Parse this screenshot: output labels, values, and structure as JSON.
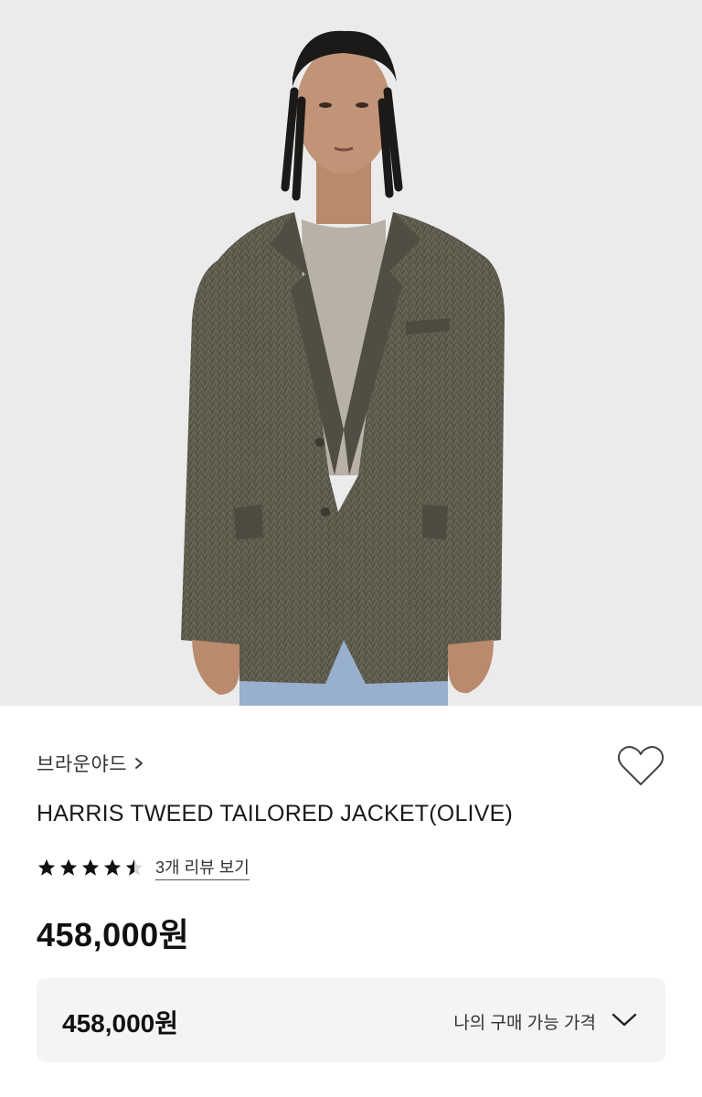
{
  "product": {
    "brand": "브라운야드",
    "name": "HARRIS TWEED TAILORED JACKET(OLIVE)",
    "rating": 4.5,
    "rating_max": 5,
    "review_link": "3개 리뷰 보기",
    "price": "458,000원"
  },
  "purchase_box": {
    "price": "458,000원",
    "label": "나의 구매 가능 가격"
  },
  "icons": {
    "brand_chevron": "chevron-right-icon",
    "wishlist": "heart-outline-icon",
    "expand": "chevron-down-icon",
    "star": "star-icon"
  },
  "colors": {
    "background": "#ffffff",
    "photo_background": "#ebebeb",
    "jacket": "#5c5a4c",
    "panel": "#f4f4f4",
    "text": "#111111"
  }
}
